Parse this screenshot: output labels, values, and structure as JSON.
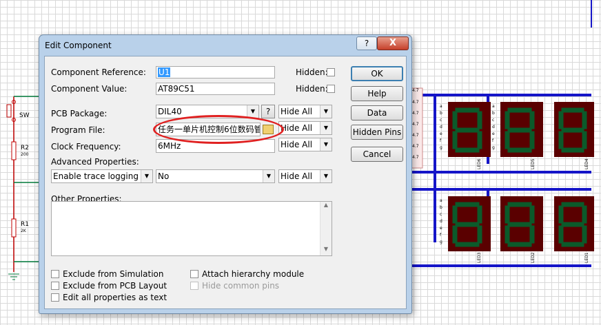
{
  "schematic": {
    "sw_label": "SW",
    "r2_label": "R2",
    "r2_value": "200",
    "r1_label": "R1",
    "r1_value": "2K",
    "segments": [
      "a",
      "b",
      "c",
      "d",
      "e",
      "f",
      "g"
    ],
    "pin_label": "4.7",
    "led_labels": [
      "LED6",
      "LED5",
      "LED4",
      "LED3",
      "LED2",
      "LED1"
    ],
    "colors": {
      "bus": "#1515c8",
      "display_bg": "#5a0000",
      "segment": "#0b5a2a",
      "wire_red": "#c00000",
      "wire_green": "#007a3a"
    }
  },
  "dialog": {
    "title": "Edit Component",
    "help_glyph": "?",
    "close_glyph": "X",
    "fields": {
      "reference_label": "Component Reference:",
      "reference_value": "U1",
      "value_label": "Component Value:",
      "value_value": "AT89C51",
      "hidden_label": "Hidden:",
      "pcb_label": "PCB Package:",
      "pcb_value": "DIL40",
      "pcb_button": "?",
      "program_label": "Program File:",
      "program_value": "任务一单片机控制6位数码管",
      "clock_label": "Clock Frequency:",
      "clock_value": "6MHz",
      "advanced_label": "Advanced Properties:",
      "advanced_value": "Enable trace logging",
      "advanced_option": "No",
      "hide_all": "Hide All",
      "other_label": "Other Properties:"
    },
    "checkboxes": {
      "exclude_sim": "Exclude from Simulation",
      "exclude_pcb": "Exclude from PCB Layout",
      "edit_all": "Edit all properties as text",
      "attach_hier": "Attach hierarchy module",
      "hide_common": "Hide common pins"
    },
    "buttons": {
      "ok": "OK",
      "help": "Help",
      "data": "Data",
      "hidden_pins": "Hidden Pins",
      "cancel": "Cancel"
    }
  }
}
